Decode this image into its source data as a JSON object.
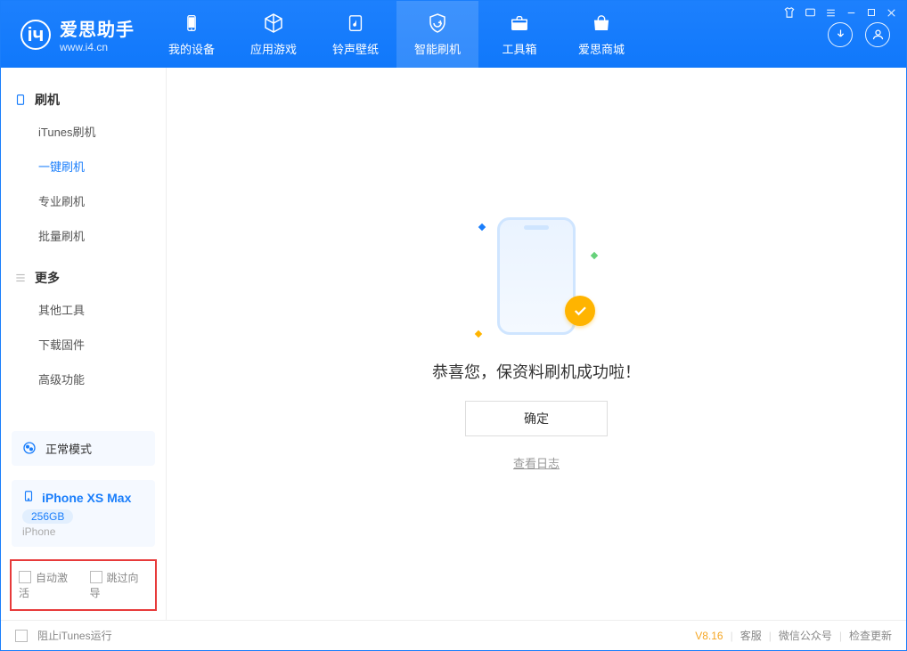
{
  "app": {
    "name": "爱思助手",
    "url": "www.i4.cn"
  },
  "topTabs": [
    {
      "label": "我的设备"
    },
    {
      "label": "应用游戏"
    },
    {
      "label": "铃声壁纸"
    },
    {
      "label": "智能刷机",
      "active": true
    },
    {
      "label": "工具箱"
    },
    {
      "label": "爱思商城"
    }
  ],
  "sidebar": {
    "groups": [
      {
        "title": "刷机",
        "items": [
          {
            "label": "iTunes刷机"
          },
          {
            "label": "一键刷机",
            "active": true
          },
          {
            "label": "专业刷机"
          },
          {
            "label": "批量刷机"
          }
        ]
      },
      {
        "title": "更多",
        "items": [
          {
            "label": "其他工具"
          },
          {
            "label": "下载固件"
          },
          {
            "label": "高级功能"
          }
        ]
      }
    ],
    "modeCard": "正常模式",
    "device": {
      "name": "iPhone XS Max",
      "storage": "256GB",
      "type": "iPhone"
    },
    "bottomOptions": {
      "opt1": "自动激活",
      "opt2": "跳过向导"
    }
  },
  "main": {
    "successText": "恭喜您，保资料刷机成功啦！",
    "okButton": "确定",
    "logLink": "查看日志"
  },
  "statusbar": {
    "blockItunes": "阻止iTunes运行",
    "version": "V8.16",
    "links": [
      "客服",
      "微信公众号",
      "检查更新"
    ]
  }
}
